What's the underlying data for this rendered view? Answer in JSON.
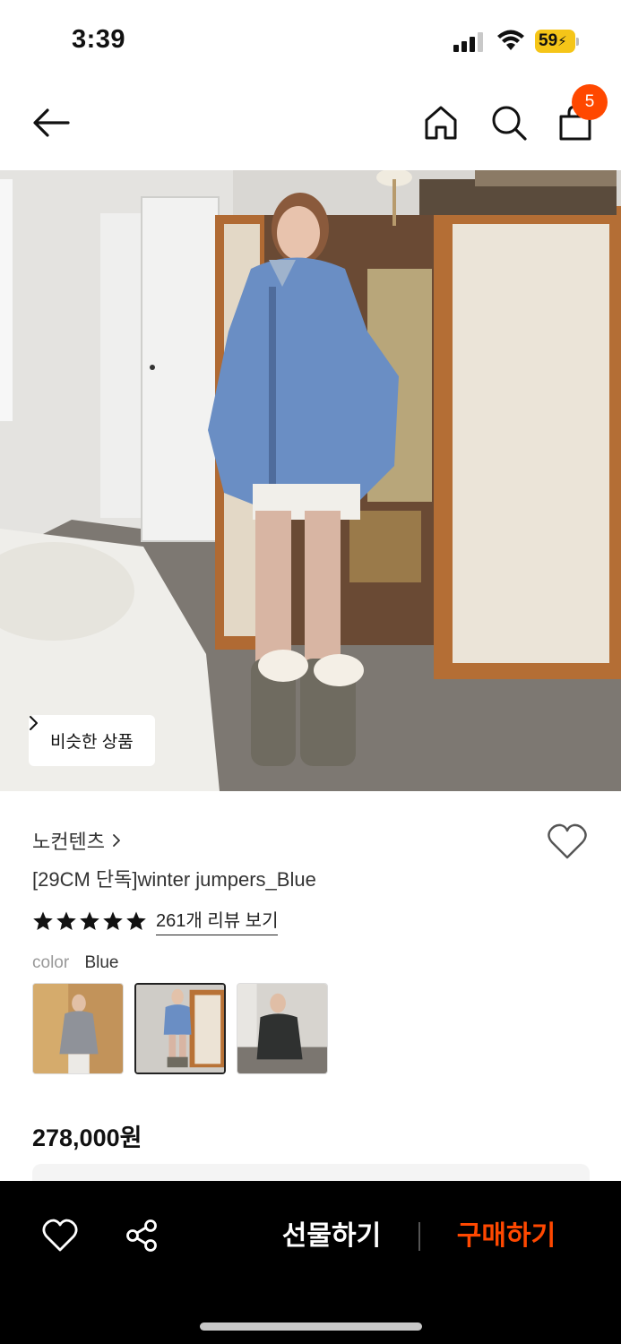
{
  "status_bar": {
    "time": "3:39",
    "battery": "59"
  },
  "nav": {
    "cart_count": "5",
    "icons": [
      "back-arrow-icon",
      "home-icon",
      "search-icon",
      "shopping-bag-icon"
    ]
  },
  "hero": {
    "similar_button_label": "비슷한 상품"
  },
  "product": {
    "brand": "노컨텐츠",
    "title": "[29CM 단독]winter jumpers_Blue",
    "rating_stars": 5,
    "reviews_link": "261개 리뷰 보기",
    "color_label": "color",
    "color_value": "Blue",
    "swatches": [
      {
        "name": "Gray"
      },
      {
        "name": "Blue",
        "selected": true
      },
      {
        "name": "Black"
      }
    ],
    "price": "278,000원"
  },
  "bottom_bar": {
    "gift_label": "선물하기",
    "buy_label": "구매하기"
  },
  "colors": {
    "accent": "#ff4800",
    "bottom_bar_bg": "#000000",
    "star": "#111111"
  }
}
